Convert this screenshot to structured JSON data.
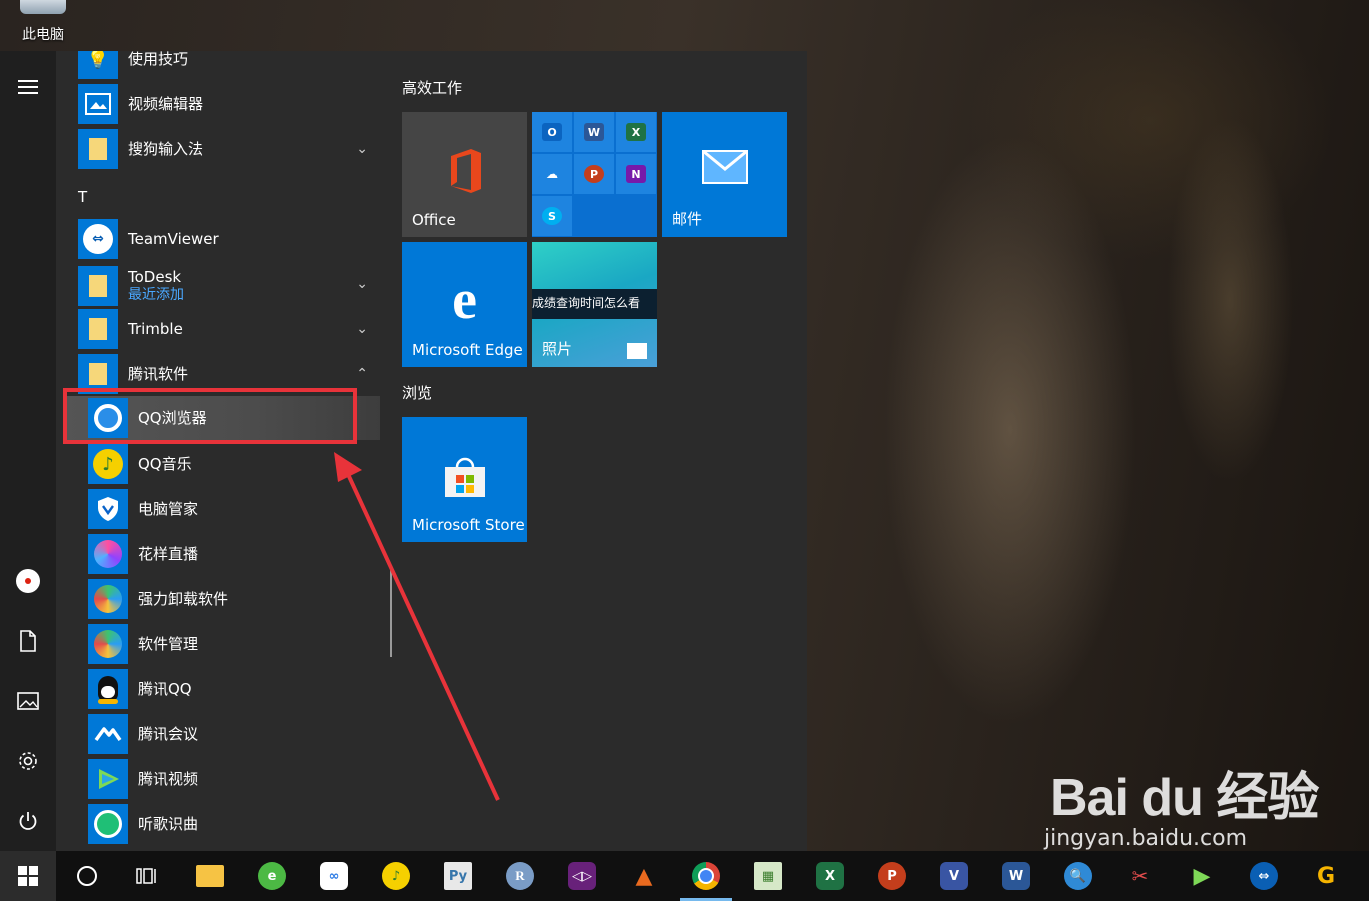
{
  "desktop": {
    "this_pc_label": "此电脑"
  },
  "start_menu": {
    "apps": [
      {
        "label": "使用技巧",
        "icon": "tips-icon"
      },
      {
        "label": "视频编辑器",
        "icon": "video-editor-icon"
      },
      {
        "label": "搜狗输入法",
        "icon": "folder-icon",
        "expandable": true
      },
      {
        "label": "TeamViewer",
        "icon": "teamviewer-icon"
      },
      {
        "label": "ToDesk",
        "sub": "最近添加",
        "icon": "folder-icon",
        "expandable": true
      },
      {
        "label": "Trimble",
        "icon": "folder-icon",
        "expandable": true
      },
      {
        "label": "腾讯软件",
        "icon": "folder-icon",
        "expanded": true
      },
      {
        "label": "QQ浏览器",
        "icon": "qq-browser-icon"
      },
      {
        "label": "QQ音乐",
        "icon": "qq-music-icon"
      },
      {
        "label": "电脑管家",
        "icon": "pc-manager-icon"
      },
      {
        "label": "花样直播",
        "icon": "live-stream-icon"
      },
      {
        "label": "强力卸载软件",
        "icon": "uninstaller-icon"
      },
      {
        "label": "软件管理",
        "icon": "software-manager-icon"
      },
      {
        "label": "腾讯QQ",
        "icon": "qq-penguin-icon"
      },
      {
        "label": "腾讯会议",
        "icon": "tencent-meeting-icon"
      },
      {
        "label": "腾讯视频",
        "icon": "tencent-video-icon"
      },
      {
        "label": "听歌识曲",
        "icon": "music-recognition-icon"
      }
    ],
    "section_letter": "T",
    "tile_groups": [
      {
        "title": "高效工作"
      },
      {
        "title": "浏览"
      }
    ],
    "tiles": {
      "office": "Office",
      "mail": "邮件",
      "edge": "Microsoft Edge",
      "photos": "照片",
      "photos_overlay": "成绩查询时间怎么看",
      "store": "Microsoft Store"
    }
  },
  "watermark": {
    "brand": "Bai du 经验",
    "url": "jingyan.baidu.com"
  },
  "colors": {
    "tile_blue": "#0078d7",
    "annotation_red": "#e8333a",
    "menu_bg": "#2b2b2b"
  }
}
